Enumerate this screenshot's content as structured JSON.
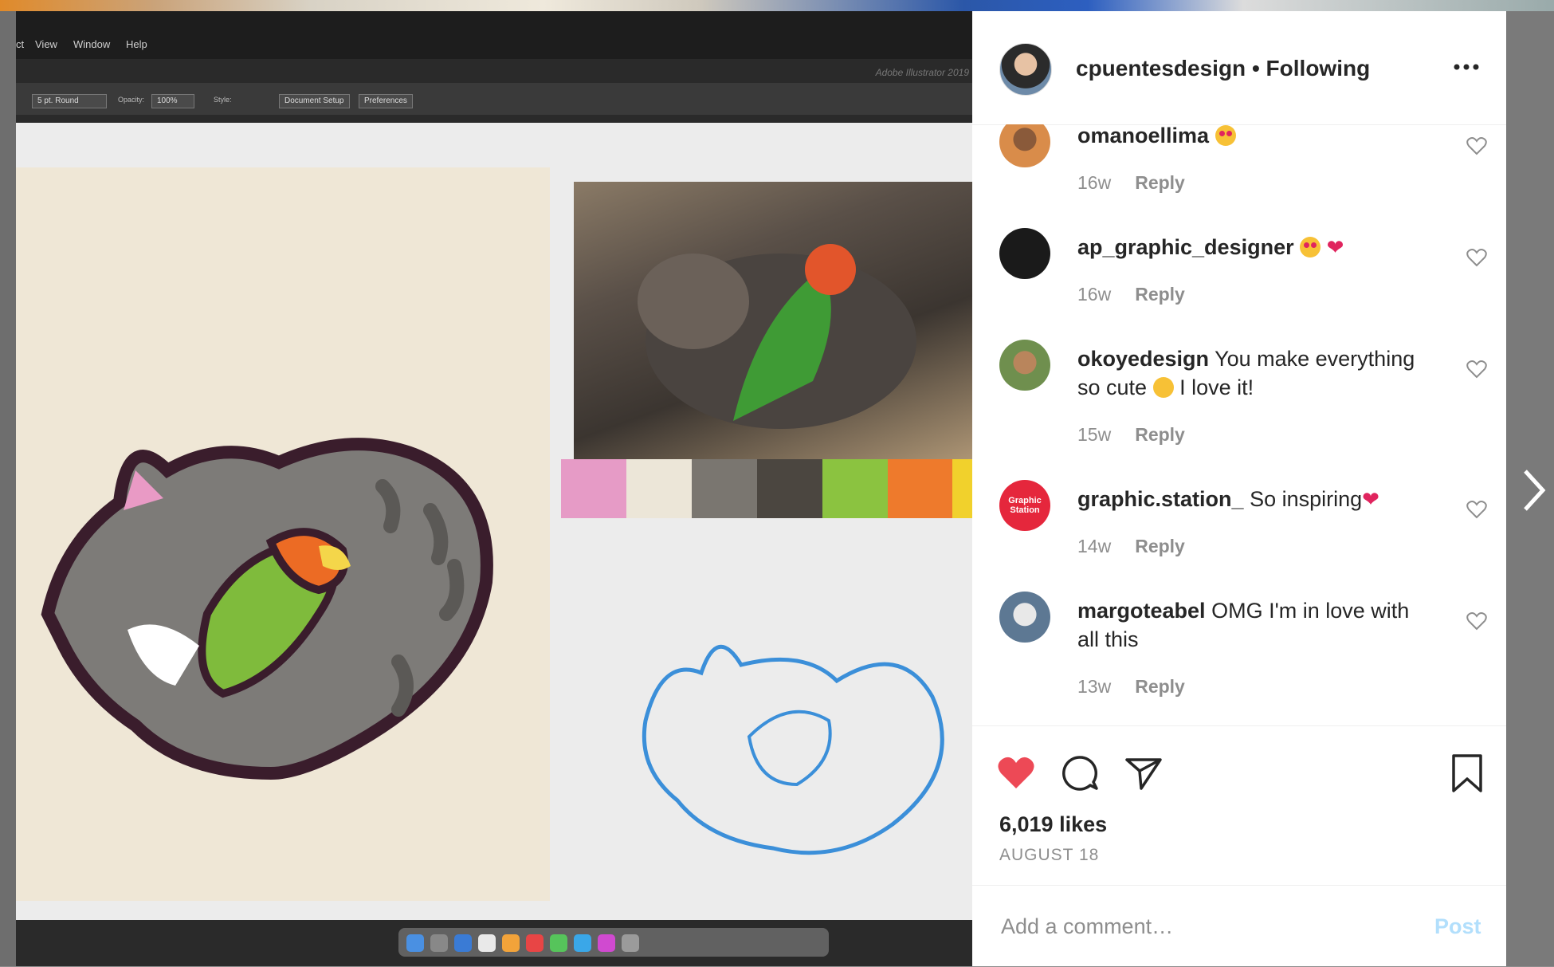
{
  "photo": {
    "menu": [
      "ct",
      "View",
      "Window",
      "Help"
    ],
    "toolbar": {
      "stroke": "5 pt. Round",
      "opacity_label": "Opacity:",
      "opacity_value": "100%",
      "style_label": "Style:",
      "document_setup": "Document Setup",
      "preferences": "Preferences"
    },
    "app_brand": "Adobe Illustrator 2019",
    "swatch_colors": [
      "#e69bc6",
      "#ece6d8",
      "#7a7670",
      "#4b4640",
      "#8bc340",
      "#ee7a2c",
      "#f1d12c"
    ]
  },
  "header": {
    "username": "cpuentesdesign",
    "separator": "•",
    "following": "Following"
  },
  "comments": [
    {
      "user": "omanoellima",
      "text": "",
      "emojis": [
        "heart-eyes"
      ],
      "time": "16w",
      "reply": "Reply"
    },
    {
      "user": "ap_graphic_designer",
      "text": "",
      "emojis": [
        "heart-eyes",
        "red-heart"
      ],
      "time": "16w",
      "reply": "Reply"
    },
    {
      "user": "okoyedesign",
      "text": "You make everything so cute",
      "text_after": "I love it!",
      "emojis": [
        "hugging"
      ],
      "time": "15w",
      "reply": "Reply"
    },
    {
      "user": "graphic.station_",
      "text": "So inspiring",
      "emojis": [
        "red-heart"
      ],
      "time": "14w",
      "reply": "Reply",
      "avatar_text": "Graphic Station"
    },
    {
      "user": "margoteabel",
      "text": "OMG I'm in love with all this",
      "emojis": [],
      "time": "13w",
      "reply": "Reply"
    }
  ],
  "actions": {
    "likes": "6,019 likes",
    "date": "AUGUST 18"
  },
  "add_comment": {
    "placeholder": "Add a comment…",
    "post": "Post"
  },
  "colors": {
    "like_red": "#ed4956",
    "post_disabled": "#b2dffc",
    "meta_gray": "#8e8e8e"
  }
}
